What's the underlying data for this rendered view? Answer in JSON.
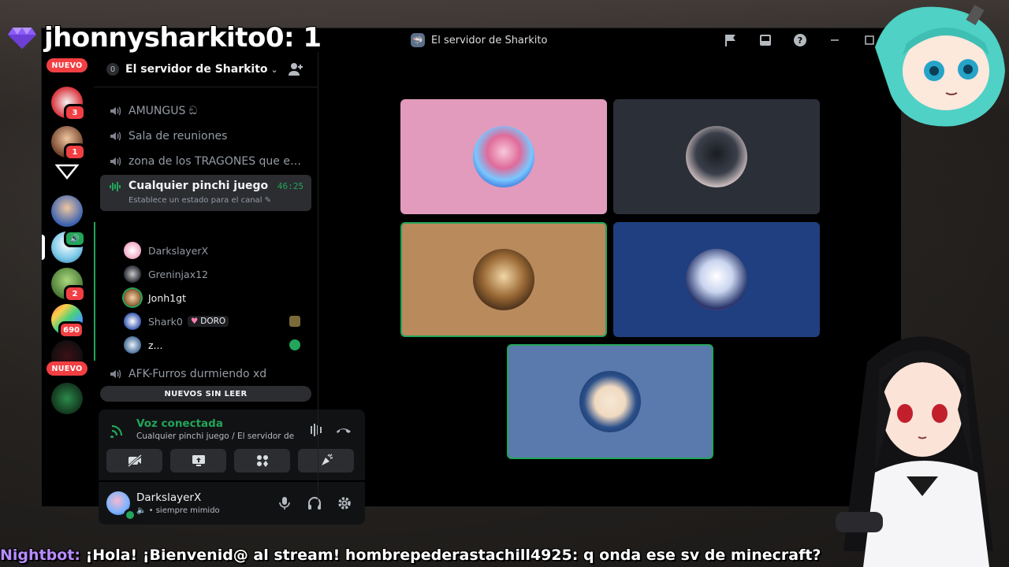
{
  "overlay": {
    "title": "jhonnysharkito0: 1",
    "gem_icon": "diamond-gem-icon"
  },
  "titlebar": {
    "server_title": "El servidor de Sharkito",
    "icons": [
      "flag-icon",
      "inbox-icon",
      "help-icon",
      "minimize-icon",
      "maximize-icon"
    ]
  },
  "rail": {
    "nuevo_top": "NUEVO",
    "nuevo_bottom": "NUEVO",
    "badges": [
      "3",
      "1",
      "2",
      "690"
    ]
  },
  "guild": {
    "badge": "0",
    "name": "El servidor de Sharkito"
  },
  "channels": [
    {
      "label": "AMUNGUS ඞ"
    },
    {
      "label": "Sala de reuniones"
    },
    {
      "label": "zona de los TRAGONES que esta..."
    },
    {
      "label": "Cualquier pinchi juego",
      "timer": "46:25",
      "status": "Establece un estado para el canal"
    }
  ],
  "voice_users": [
    {
      "name": "DarkslayerX"
    },
    {
      "name": "Greninjax12"
    },
    {
      "name": "Jonh1gt"
    },
    {
      "name": "Shark0",
      "tag": "DORO"
    },
    {
      "name": "z..."
    }
  ],
  "afk_channel": "AFK-Furros durmiendo xd",
  "unread_label": "NUEVOS SIN LEER",
  "voice_panel": {
    "title": "Voz conectada",
    "subtitle": "Cualquier pinchi juego / El servidor de S..."
  },
  "user_panel": {
    "name": "DarkslayerX",
    "status": "siempre mimido"
  },
  "colors": {
    "green": "#23a55a",
    "red": "#f23f43",
    "tile_pink": "#e29bbd",
    "tile_slate": "#2b2f38",
    "tile_tan": "#b98a5c",
    "tile_navy": "#1f3f80",
    "tile_steel": "#5a7aad"
  },
  "chat": {
    "user": "Nightbot:",
    "message": "¡Hola! ¡Bienvenid@ al stream! hombrepederastachill4925: q onda ese sv de minecraft?"
  }
}
